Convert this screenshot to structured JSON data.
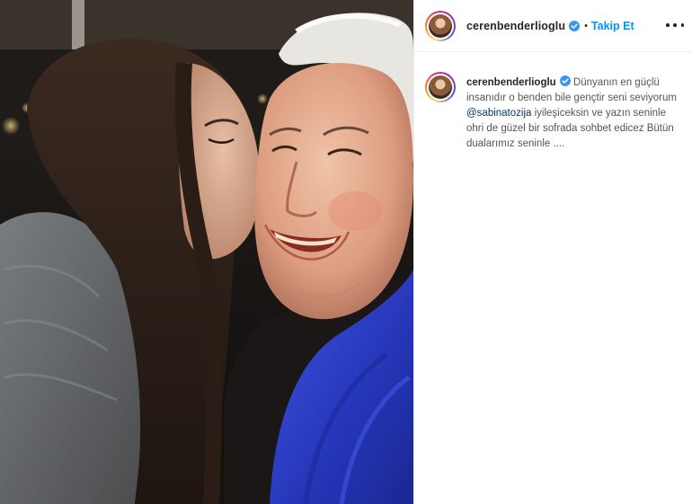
{
  "post": {
    "username": "cerenbenderlioglu",
    "verified": true,
    "separator": "•",
    "follow_label": "Takip Et",
    "more_icon": "more-horizontal-icon"
  },
  "caption": {
    "username": "cerenbenderlioglu",
    "text_part1": " Dünyanın en güçlü insanıdır o benden bile gençtir seni seviyorum ",
    "mention": "@sabinatozija",
    "text_part2": " iyileşiceksin ve yazın seninle ohri de güzel bir sofrada sohbet edicez Bütün dualarımız seninle ...."
  },
  "colors": {
    "accent": "#0095f6",
    "verified": "#3897f0",
    "text": "#262626",
    "mention": "#00376b",
    "scarf": "#2a3fd0",
    "sweater": "#6b6e70"
  },
  "photo": {
    "description_icon": "photo-image"
  }
}
